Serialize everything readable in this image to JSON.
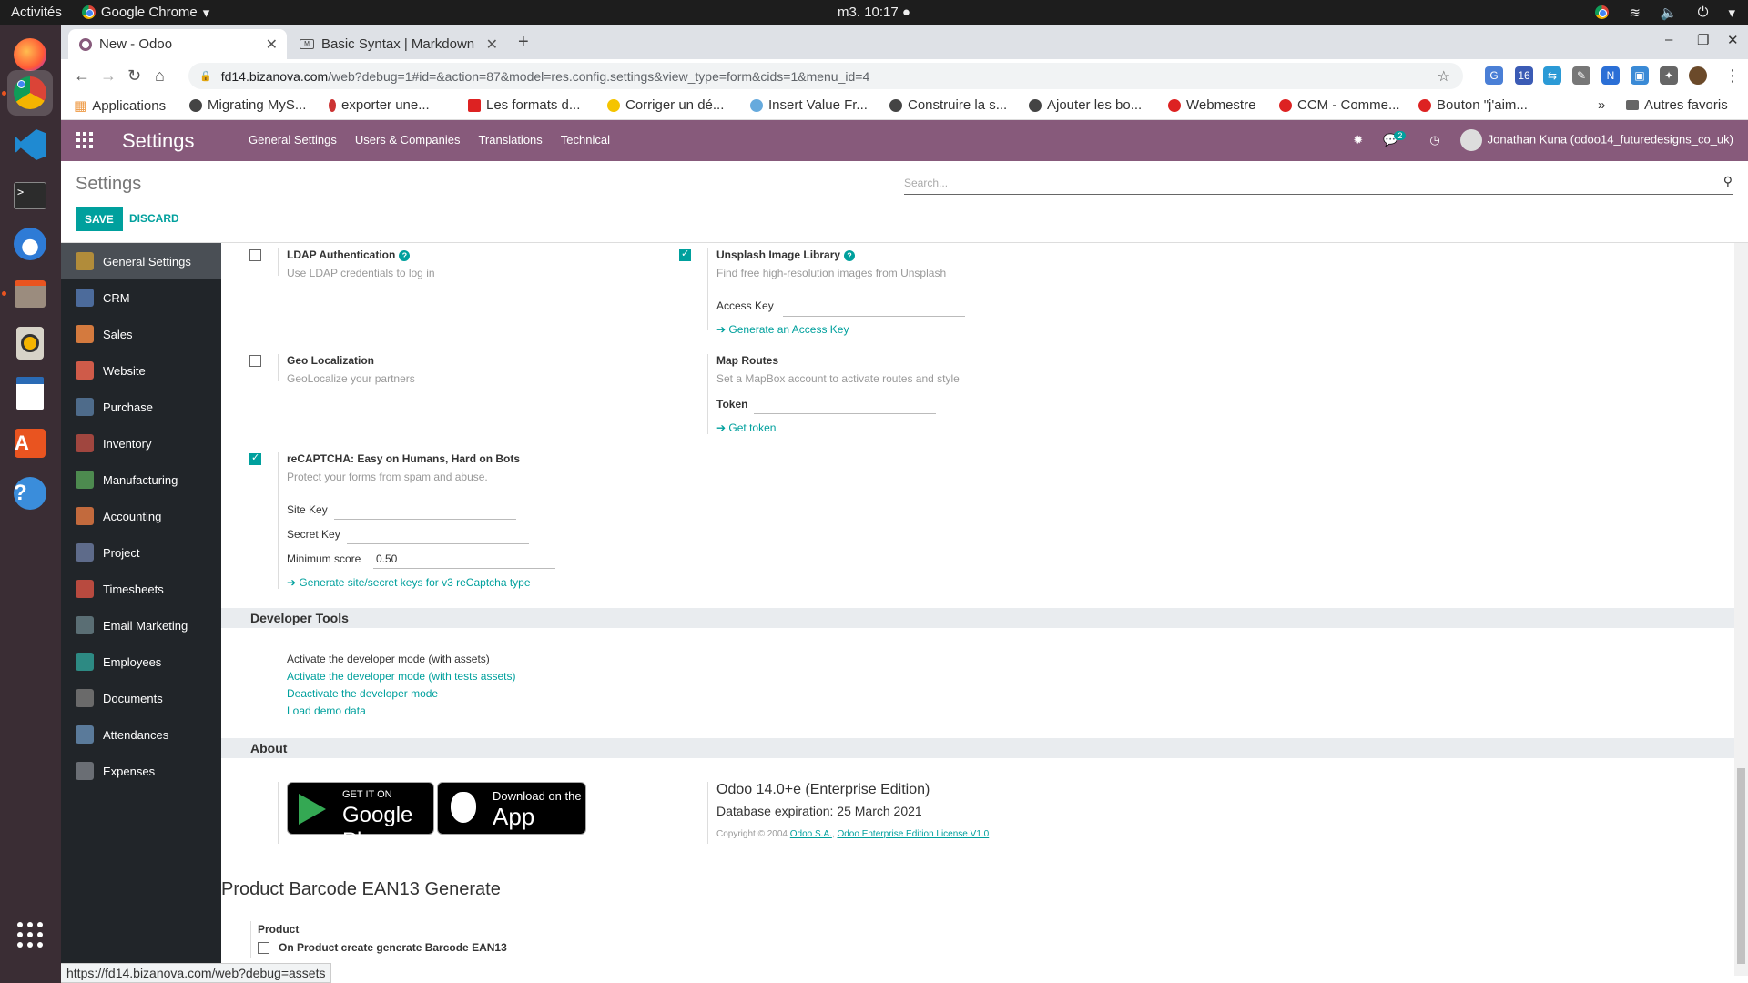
{
  "os": {
    "activities": "Activités",
    "app_menu": "Google Chrome",
    "clock": "m3. 10:17"
  },
  "browser": {
    "tabs": [
      {
        "label": "New - Odoo",
        "close": "✕"
      },
      {
        "label": "Basic Syntax | Markdown",
        "close": "✕"
      }
    ],
    "new_tab": "+",
    "url_host": "fd14.bizanova.com",
    "url_path": "/web?debug=1#id=&action=87&model=res.config.settings&view_type=form&cids=1&menu_id=4",
    "bookmarks": [
      "Applications",
      "Migrating MyS...",
      "exporter une...",
      "Les formats d...",
      "Corriger un dé...",
      "Insert Value Fr...",
      "Construire la s...",
      "Ajouter les bo...",
      "Webmestre",
      "CCM - Comme...",
      "Bouton \"j'aim..."
    ],
    "bookmarks_more": "»",
    "other_bookmarks": "Autres favoris",
    "status_url": "https://fd14.bizanova.com/web?debug=assets"
  },
  "odoo_nav": {
    "brand": "Settings",
    "menu": [
      "General Settings",
      "Users & Companies",
      "Translations",
      "Technical"
    ],
    "chat_badge": "2",
    "user": "Jonathan Kuna (odoo14_futuredesigns_co_uk)"
  },
  "control": {
    "breadcrumb": "Settings",
    "save": "SAVE",
    "discard": "DISCARD",
    "search_placeholder": "Search..."
  },
  "sidebar": {
    "items": [
      {
        "label": "General Settings",
        "color": "#b18c3a"
      },
      {
        "label": "CRM",
        "color": "#4c6b9b"
      },
      {
        "label": "Sales",
        "color": "#d47a3e"
      },
      {
        "label": "Website",
        "color": "#cf5b49"
      },
      {
        "label": "Purchase",
        "color": "#4e6b8a"
      },
      {
        "label": "Inventory",
        "color": "#a0463f"
      },
      {
        "label": "Manufacturing",
        "color": "#4d8a4f"
      },
      {
        "label": "Accounting",
        "color": "#c26a3d"
      },
      {
        "label": "Project",
        "color": "#5e6b8a"
      },
      {
        "label": "Timesheets",
        "color": "#b84a3f"
      },
      {
        "label": "Email Marketing",
        "color": "#5a6e74"
      },
      {
        "label": "Employees",
        "color": "#2d8a83"
      },
      {
        "label": "Documents",
        "color": "#6a6a6a"
      },
      {
        "label": "Attendances",
        "color": "#5a7a9a"
      },
      {
        "label": "Expenses",
        "color": "#6a6e74"
      }
    ]
  },
  "settings": {
    "ldap": {
      "title": "LDAP Authentication",
      "desc": "Use LDAP credentials to log in",
      "checked": false
    },
    "unsplash": {
      "title": "Unsplash Image Library",
      "desc": "Find free high-resolution images from Unsplash",
      "checked": true,
      "access_key_label": "Access Key",
      "generate_link": "Generate an Access Key"
    },
    "geo": {
      "title": "Geo Localization",
      "desc": "GeoLocalize your partners",
      "checked": false
    },
    "map_routes": {
      "title": "Map Routes",
      "desc": "Set a MapBox account to activate routes and style",
      "token_label": "Token",
      "get_token_link": "Get token"
    },
    "recaptcha": {
      "title": "reCAPTCHA: Easy on Humans, Hard on Bots",
      "desc": "Protect your forms from spam and abuse.",
      "checked": true,
      "site_key_label": "Site Key",
      "secret_key_label": "Secret Key",
      "min_score_label": "Minimum score",
      "min_score_value": "0.50",
      "generate_link": "Generate site/secret keys for v3 reCaptcha type"
    },
    "developer": {
      "heading": "Developer Tools",
      "links": [
        "Activate the developer mode (with assets)",
        "Activate the developer mode (with tests assets)",
        "Deactivate the developer mode",
        "Load demo data"
      ]
    },
    "about": {
      "heading": "About",
      "google_top": "GET IT ON",
      "google_bottom": "Google Play",
      "apple_top": "Download on the",
      "apple_bottom": "App Store",
      "version": "Odoo 14.0+e (Enterprise Edition)",
      "expiration": "Database expiration: 25 March 2021",
      "copyright": "Copyright © 2004",
      "odoo_sa": "Odoo S.A.",
      "license": "Odoo Enterprise Edition License V1.0"
    },
    "barcode": {
      "heading": "Product Barcode EAN13 Generate",
      "sub": "Product",
      "option": "On Product create generate Barcode EAN13",
      "checked": false
    }
  }
}
